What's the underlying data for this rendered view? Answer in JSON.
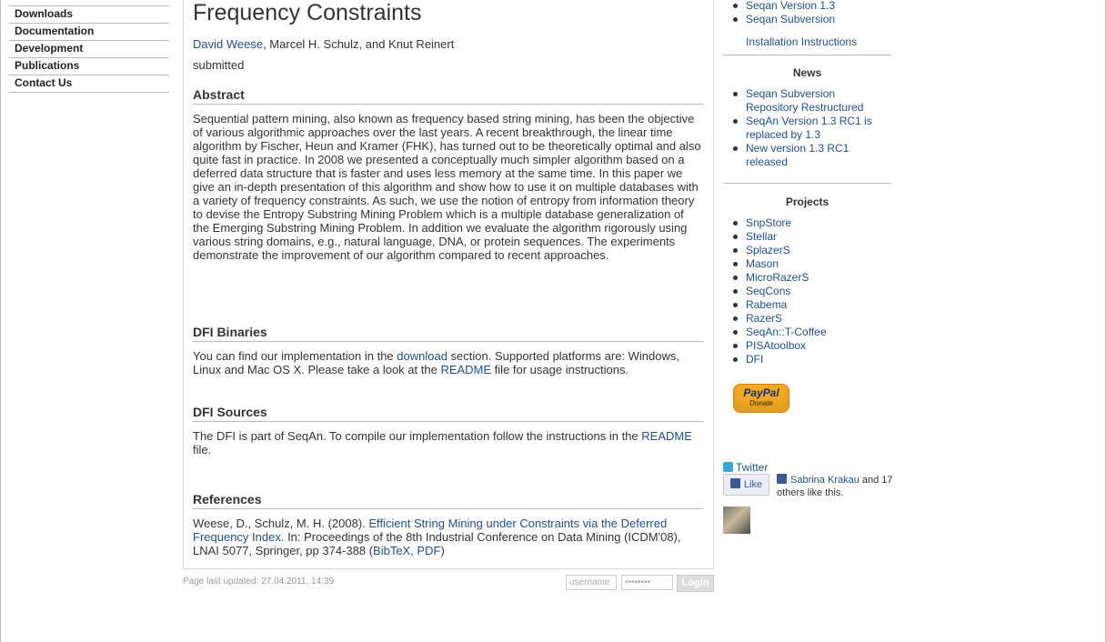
{
  "nav": {
    "items": [
      "Downloads",
      "Documentation",
      "Development",
      "Publications",
      "Contact Us"
    ]
  },
  "paper": {
    "title": "Frequency Constraints",
    "author_link": "David Weese",
    "authors_rest": ", Marcel H. Schulz, and Knut Reinert",
    "status": "submitted"
  },
  "abstract": {
    "heading": "Abstract",
    "text": "Sequential pattern mining, also known as frequency based string mining, has been the objective of various algorithmic approaches over the last years. A recent breakthrough, the linear time algorithm by Fischer, Heun and Kramer (FHK), has turned out to be theoretically optimal and also quite fast in practice. In 2008 we presented a conceptually much simpler algorithm based on a deferred data structure that is faster and uses less memory at the same time. In this paper we give an in-depth presentation of this algorithm and show how to use it on multiple databases with a variety of frequency constraints. As such, we use the notion of entropy from information theory to devise the Entropy Substring Mining Problem which is a multiple database generalization of the Emerging Substring Mining Problem. In addition we evaluate the algorithm rigorously using various string domains, e.g., natural language, DNA, or protein sequences. The experiments demonstrate the improvement of our algorithm compared to recent approaches."
  },
  "binaries": {
    "heading": "DFI Binaries",
    "text_1": "You can find our implementation in the ",
    "link_download": "download",
    "text_2": " section. Supported platforms are: Windows, Linux and Mac OS X. Please take a look at the ",
    "link_readme": "README",
    "text_3": " file for usage instructions."
  },
  "sources": {
    "heading": "DFI Sources",
    "text_1": "The DFI is part of SeqAn. To compile our implementation follow the instructions in the ",
    "link_readme": "README",
    "text_2": " file."
  },
  "references": {
    "heading": "References",
    "text_1": "Weese, D., Schulz, M. H. (2008). ",
    "link_paper": "Efficient String Mining under Constraints via the Deferred Frequency Index",
    "text_2": ". In: Proceedings of the 8th Industrial Conference on Data Mining (ICDM'08), LNAI 5077, Springer, pp 374-388 (",
    "link_bibtex": "BibTeX",
    "sep": ", ",
    "link_pdf": "PDF",
    "text_3": ")"
  },
  "footer": {
    "updated": "Page last updated: 27.04.2011, 14:39",
    "username_placeholder": "username",
    "password_placeholder": "••••••••",
    "login_label": "Login"
  },
  "sidebar": {
    "downloads": [
      "Seqan Version 1.3",
      "Seqan Subversion"
    ],
    "install_link": "Installation Instructions",
    "news_heading": "News",
    "news": [
      "Seqan Subversion Repository Restructured",
      "SeqAn Version 1.3 RC1 is replaced by 1.3",
      "New version 1.3 RC1 released"
    ],
    "projects_heading": "Projects",
    "projects": [
      "SnpStore",
      "Stellar",
      "SplazerS",
      "Mason",
      "MicroRazerS",
      "SeqCons",
      "Rabema",
      "RazerS",
      "SeqAn::T-Coffee",
      "PISAtoolbox",
      "DFI"
    ],
    "paypal_logo": "PayPal",
    "paypal_donate": "Donate",
    "twitter": "Twitter",
    "like_label": "Like",
    "fb_name": "Sabrina Krakau",
    "fb_rest": " and 17 others like this."
  },
  "colors": {
    "link": "#1f4f8a",
    "text": "#333333",
    "paypal": "#f4a91e"
  }
}
